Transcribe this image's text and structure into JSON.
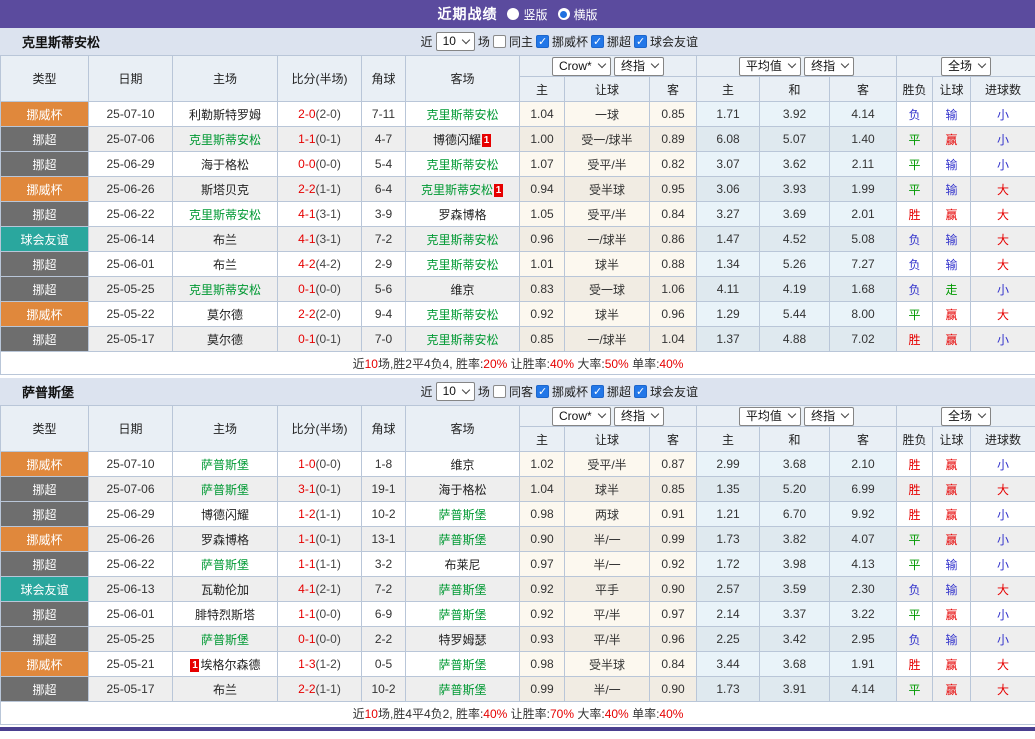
{
  "page": {
    "title": "近期战绩",
    "radio_vertical": "竖版",
    "radio_horizontal": "横版"
  },
  "controls": {
    "recent_label": "近",
    "recent_value": "10",
    "games_label": "场",
    "filters": [
      "挪威杯",
      "挪超",
      "球会友谊"
    ]
  },
  "headers": {
    "left": [
      "类型",
      "日期",
      "主场",
      "比分(半场)",
      "角球",
      "客场"
    ],
    "odds_select": "Crow*",
    "odds_period_select": "终指",
    "avg_select": "平均值",
    "avg_period_select": "终指",
    "scope_select": "全场",
    "odds_sub": [
      "主",
      "让球",
      "客"
    ],
    "avg_sub": [
      "主",
      "和",
      "客"
    ],
    "result_sub": [
      "胜负",
      "让球",
      "进球数"
    ]
  },
  "type_colors": {
    "挪威杯": "#e0883c",
    "挪超": "#6e6e6e",
    "球会友谊": "#2aa79e"
  },
  "result_colors": {
    "r": "#e60000",
    "g": "#009900",
    "b": "#3333cc"
  },
  "accent": {
    "topbar": "#5b4b9e",
    "team_green": "#009933",
    "score_red": "#e60000"
  },
  "tables": [
    {
      "team": "克里斯蒂安松",
      "same_label": "同主",
      "rows": [
        {
          "type": "挪威杯",
          "date": "25-07-10",
          "home": {
            "name": "利勒斯特罗姆"
          },
          "score": {
            "ft": "2-0",
            "ht": "(2-0)"
          },
          "corner": "7-11",
          "away": {
            "name": "克里斯蒂安松",
            "green": true
          },
          "odds": [
            "1.04",
            "一球",
            "0.85"
          ],
          "avg": [
            "1.71",
            "3.92",
            "4.14"
          ],
          "result": [
            [
              "负",
              "b"
            ],
            [
              "输",
              "b"
            ],
            [
              "小",
              "b"
            ]
          ]
        },
        {
          "type": "挪超",
          "date": "25-07-06",
          "home": {
            "name": "克里斯蒂安松",
            "green": true
          },
          "score": {
            "ft": "1-1",
            "ht": "(0-1)"
          },
          "corner": "4-7",
          "away": {
            "name": "博德闪耀",
            "badge": "1",
            "badge_pos": "after"
          },
          "odds": [
            "1.00",
            "受一/球半",
            "0.89"
          ],
          "avg": [
            "6.08",
            "5.07",
            "1.40"
          ],
          "result": [
            [
              "平",
              "g"
            ],
            [
              "赢",
              "r"
            ],
            [
              "小",
              "b"
            ]
          ]
        },
        {
          "type": "挪超",
          "date": "25-06-29",
          "home": {
            "name": "海于格松"
          },
          "score": {
            "ft": "0-0",
            "ht": "(0-0)"
          },
          "corner": "5-4",
          "away": {
            "name": "克里斯蒂安松",
            "green": true
          },
          "odds": [
            "1.07",
            "受平/半",
            "0.82"
          ],
          "avg": [
            "3.07",
            "3.62",
            "2.11"
          ],
          "result": [
            [
              "平",
              "g"
            ],
            [
              "输",
              "b"
            ],
            [
              "小",
              "b"
            ]
          ]
        },
        {
          "type": "挪威杯",
          "date": "25-06-26",
          "home": {
            "name": "斯塔贝克"
          },
          "score": {
            "ft": "2-2",
            "ht": "(1-1)"
          },
          "corner": "6-4",
          "away": {
            "name": "克里斯蒂安松",
            "green": true,
            "badge": "1",
            "badge_pos": "after"
          },
          "odds": [
            "0.94",
            "受半球",
            "0.95"
          ],
          "avg": [
            "3.06",
            "3.93",
            "1.99"
          ],
          "result": [
            [
              "平",
              "g"
            ],
            [
              "输",
              "b"
            ],
            [
              "大",
              "r"
            ]
          ]
        },
        {
          "type": "挪超",
          "date": "25-06-22",
          "home": {
            "name": "克里斯蒂安松",
            "green": true
          },
          "score": {
            "ft": "4-1",
            "ht": "(3-1)"
          },
          "corner": "3-9",
          "away": {
            "name": "罗森博格"
          },
          "odds": [
            "1.05",
            "受平/半",
            "0.84"
          ],
          "avg": [
            "3.27",
            "3.69",
            "2.01"
          ],
          "result": [
            [
              "胜",
              "r"
            ],
            [
              "赢",
              "r"
            ],
            [
              "大",
              "r"
            ]
          ]
        },
        {
          "type": "球会友谊",
          "date": "25-06-14",
          "home": {
            "name": "布兰"
          },
          "score": {
            "ft": "4-1",
            "ht": "(3-1)"
          },
          "corner": "7-2",
          "away": {
            "name": "克里斯蒂安松",
            "green": true
          },
          "odds": [
            "0.96",
            "一/球半",
            "0.86"
          ],
          "avg": [
            "1.47",
            "4.52",
            "5.08"
          ],
          "result": [
            [
              "负",
              "b"
            ],
            [
              "输",
              "b"
            ],
            [
              "大",
              "r"
            ]
          ]
        },
        {
          "type": "挪超",
          "date": "25-06-01",
          "home": {
            "name": "布兰"
          },
          "score": {
            "ft": "4-2",
            "ht": "(4-2)"
          },
          "corner": "2-9",
          "away": {
            "name": "克里斯蒂安松",
            "green": true
          },
          "odds": [
            "1.01",
            "球半",
            "0.88"
          ],
          "avg": [
            "1.34",
            "5.26",
            "7.27"
          ],
          "result": [
            [
              "负",
              "b"
            ],
            [
              "输",
              "b"
            ],
            [
              "大",
              "r"
            ]
          ]
        },
        {
          "type": "挪超",
          "date": "25-05-25",
          "home": {
            "name": "克里斯蒂安松",
            "green": true
          },
          "score": {
            "ft": "0-1",
            "ht": "(0-0)"
          },
          "corner": "5-6",
          "away": {
            "name": "维京"
          },
          "odds": [
            "0.83",
            "受一球",
            "1.06"
          ],
          "avg": [
            "4.11",
            "4.19",
            "1.68"
          ],
          "result": [
            [
              "负",
              "b"
            ],
            [
              "走",
              "g"
            ],
            [
              "小",
              "b"
            ]
          ]
        },
        {
          "type": "挪威杯",
          "date": "25-05-22",
          "home": {
            "name": "莫尔德"
          },
          "score": {
            "ft": "2-2",
            "ht": "(2-0)"
          },
          "corner": "9-4",
          "away": {
            "name": "克里斯蒂安松",
            "green": true
          },
          "odds": [
            "0.92",
            "球半",
            "0.96"
          ],
          "avg": [
            "1.29",
            "5.44",
            "8.00"
          ],
          "result": [
            [
              "平",
              "g"
            ],
            [
              "赢",
              "r"
            ],
            [
              "大",
              "r"
            ]
          ]
        },
        {
          "type": "挪超",
          "date": "25-05-17",
          "home": {
            "name": "莫尔德"
          },
          "score": {
            "ft": "0-1",
            "ht": "(0-1)"
          },
          "corner": "7-0",
          "away": {
            "name": "克里斯蒂安松",
            "green": true
          },
          "odds": [
            "0.85",
            "一/球半",
            "1.04"
          ],
          "avg": [
            "1.37",
            "4.88",
            "7.02"
          ],
          "result": [
            [
              "胜",
              "r"
            ],
            [
              "赢",
              "r"
            ],
            [
              "小",
              "b"
            ]
          ]
        }
      ],
      "summary": [
        [
          "近",
          "k"
        ],
        [
          "10",
          "r"
        ],
        [
          "场,胜2平4负4, 胜率:",
          "k"
        ],
        [
          "20%",
          "r"
        ],
        [
          " 让胜率:",
          "k"
        ],
        [
          "40%",
          "r"
        ],
        [
          " 大率:",
          "k"
        ],
        [
          "50%",
          "r"
        ],
        [
          " 单率:",
          "k"
        ],
        [
          "40%",
          "r"
        ]
      ]
    },
    {
      "team": "萨普斯堡",
      "same_label": "同客",
      "rows": [
        {
          "type": "挪威杯",
          "date": "25-07-10",
          "home": {
            "name": "萨普斯堡",
            "green": true
          },
          "score": {
            "ft": "1-0",
            "ht": "(0-0)"
          },
          "corner": "1-8",
          "away": {
            "name": "维京"
          },
          "odds": [
            "1.02",
            "受平/半",
            "0.87"
          ],
          "avg": [
            "2.99",
            "3.68",
            "2.10"
          ],
          "result": [
            [
              "胜",
              "r"
            ],
            [
              "赢",
              "r"
            ],
            [
              "小",
              "b"
            ]
          ]
        },
        {
          "type": "挪超",
          "date": "25-07-06",
          "home": {
            "name": "萨普斯堡",
            "green": true
          },
          "score": {
            "ft": "3-1",
            "ht": "(0-1)"
          },
          "corner": "19-1",
          "away": {
            "name": "海于格松"
          },
          "odds": [
            "1.04",
            "球半",
            "0.85"
          ],
          "avg": [
            "1.35",
            "5.20",
            "6.99"
          ],
          "result": [
            [
              "胜",
              "r"
            ],
            [
              "赢",
              "r"
            ],
            [
              "大",
              "r"
            ]
          ]
        },
        {
          "type": "挪超",
          "date": "25-06-29",
          "home": {
            "name": "博德闪耀"
          },
          "score": {
            "ft": "1-2",
            "ht": "(1-1)"
          },
          "corner": "10-2",
          "away": {
            "name": "萨普斯堡",
            "green": true
          },
          "odds": [
            "0.98",
            "两球",
            "0.91"
          ],
          "avg": [
            "1.21",
            "6.70",
            "9.92"
          ],
          "result": [
            [
              "胜",
              "r"
            ],
            [
              "赢",
              "r"
            ],
            [
              "小",
              "b"
            ]
          ]
        },
        {
          "type": "挪威杯",
          "date": "25-06-26",
          "home": {
            "name": "罗森博格"
          },
          "score": {
            "ft": "1-1",
            "ht": "(0-1)"
          },
          "corner": "13-1",
          "away": {
            "name": "萨普斯堡",
            "green": true
          },
          "odds": [
            "0.90",
            "半/一",
            "0.99"
          ],
          "avg": [
            "1.73",
            "3.82",
            "4.07"
          ],
          "result": [
            [
              "平",
              "g"
            ],
            [
              "赢",
              "r"
            ],
            [
              "小",
              "b"
            ]
          ]
        },
        {
          "type": "挪超",
          "date": "25-06-22",
          "home": {
            "name": "萨普斯堡",
            "green": true
          },
          "score": {
            "ft": "1-1",
            "ht": "(1-1)"
          },
          "corner": "3-2",
          "away": {
            "name": "布莱尼"
          },
          "odds": [
            "0.97",
            "半/一",
            "0.92"
          ],
          "avg": [
            "1.72",
            "3.98",
            "4.13"
          ],
          "result": [
            [
              "平",
              "g"
            ],
            [
              "输",
              "b"
            ],
            [
              "小",
              "b"
            ]
          ]
        },
        {
          "type": "球会友谊",
          "date": "25-06-13",
          "home": {
            "name": "瓦勒伦加"
          },
          "score": {
            "ft": "4-1",
            "ht": "(2-1)"
          },
          "corner": "7-2",
          "away": {
            "name": "萨普斯堡",
            "green": true
          },
          "odds": [
            "0.92",
            "平手",
            "0.90"
          ],
          "avg": [
            "2.57",
            "3.59",
            "2.30"
          ],
          "result": [
            [
              "负",
              "b"
            ],
            [
              "输",
              "b"
            ],
            [
              "大",
              "r"
            ]
          ]
        },
        {
          "type": "挪超",
          "date": "25-06-01",
          "home": {
            "name": "腓特烈斯塔"
          },
          "score": {
            "ft": "1-1",
            "ht": "(0-0)"
          },
          "corner": "6-9",
          "away": {
            "name": "萨普斯堡",
            "green": true
          },
          "odds": [
            "0.92",
            "平/半",
            "0.97"
          ],
          "avg": [
            "2.14",
            "3.37",
            "3.22"
          ],
          "result": [
            [
              "平",
              "g"
            ],
            [
              "赢",
              "r"
            ],
            [
              "小",
              "b"
            ]
          ]
        },
        {
          "type": "挪超",
          "date": "25-05-25",
          "home": {
            "name": "萨普斯堡",
            "green": true
          },
          "score": {
            "ft": "0-1",
            "ht": "(0-0)"
          },
          "corner": "2-2",
          "away": {
            "name": "特罗姆瑟"
          },
          "odds": [
            "0.93",
            "平/半",
            "0.96"
          ],
          "avg": [
            "2.25",
            "3.42",
            "2.95"
          ],
          "result": [
            [
              "负",
              "b"
            ],
            [
              "输",
              "b"
            ],
            [
              "小",
              "b"
            ]
          ]
        },
        {
          "type": "挪威杯",
          "date": "25-05-21",
          "home": {
            "name": "埃格尔森德",
            "badge": "1",
            "badge_pos": "before"
          },
          "score": {
            "ft": "1-3",
            "ht": "(1-2)"
          },
          "corner": "0-5",
          "away": {
            "name": "萨普斯堡",
            "green": true
          },
          "odds": [
            "0.98",
            "受半球",
            "0.84"
          ],
          "avg": [
            "3.44",
            "3.68",
            "1.91"
          ],
          "result": [
            [
              "胜",
              "r"
            ],
            [
              "赢",
              "r"
            ],
            [
              "大",
              "r"
            ]
          ]
        },
        {
          "type": "挪超",
          "date": "25-05-17",
          "home": {
            "name": "布兰"
          },
          "score": {
            "ft": "2-2",
            "ht": "(1-1)"
          },
          "corner": "10-2",
          "away": {
            "name": "萨普斯堡",
            "green": true
          },
          "odds": [
            "0.99",
            "半/一",
            "0.90"
          ],
          "avg": [
            "1.73",
            "3.91",
            "4.14"
          ],
          "result": [
            [
              "平",
              "g"
            ],
            [
              "赢",
              "r"
            ],
            [
              "大",
              "r"
            ]
          ]
        }
      ],
      "summary": [
        [
          "近",
          "k"
        ],
        [
          "10",
          "r"
        ],
        [
          "场,胜4平4负2, 胜率:",
          "k"
        ],
        [
          "40%",
          "r"
        ],
        [
          " 让胜率:",
          "k"
        ],
        [
          "70%",
          "r"
        ],
        [
          " 大率:",
          "k"
        ],
        [
          "40%",
          "r"
        ],
        [
          " 单率:",
          "k"
        ],
        [
          "40%",
          "r"
        ]
      ]
    }
  ]
}
